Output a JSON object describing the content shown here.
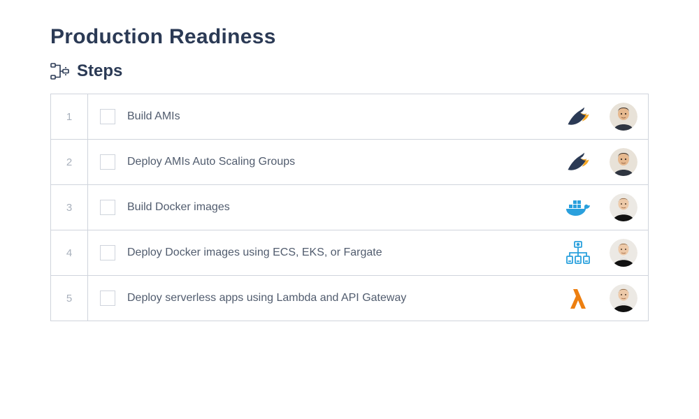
{
  "page": {
    "title": "Production Readiness",
    "steps_heading": "Steps"
  },
  "steps": [
    {
      "num": "1",
      "label": "Build AMIs",
      "tech_icon": "bird",
      "avatar": "person-a"
    },
    {
      "num": "2",
      "label": "Deploy AMIs Auto Scaling Groups",
      "tech_icon": "bird",
      "avatar": "person-a"
    },
    {
      "num": "3",
      "label": "Build Docker images",
      "tech_icon": "docker",
      "avatar": "person-b"
    },
    {
      "num": "4",
      "label": "Deploy Docker images using ECS, EKS, or Fargate",
      "tech_icon": "orchestration",
      "avatar": "person-b"
    },
    {
      "num": "5",
      "label": "Deploy serverless apps using Lambda and API Gateway",
      "tech_icon": "lambda",
      "avatar": "person-b"
    }
  ],
  "icons": {
    "bird": "bird-icon",
    "docker": "docker-icon",
    "orchestration": "orchestration-icon",
    "lambda": "lambda-icon"
  },
  "avatars": {
    "person-a": "avatar-person-a",
    "person-b": "avatar-person-b"
  }
}
